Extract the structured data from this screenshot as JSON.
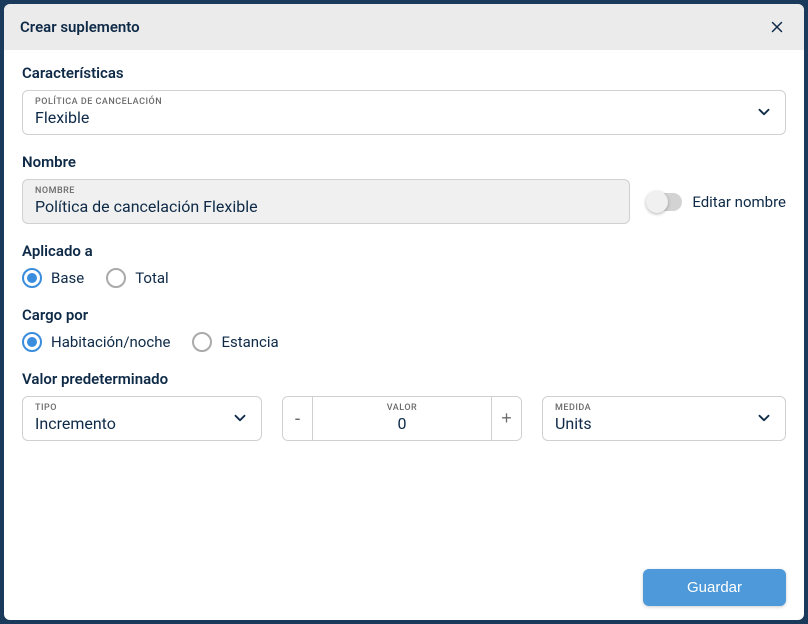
{
  "modal": {
    "title": "Crear suplemento",
    "footer": {
      "save_label": "Guardar"
    }
  },
  "caracteristicas": {
    "section_title": "Características",
    "select": {
      "label": "POLÍTICA DE CANCELACIÓN",
      "value": "Flexible"
    }
  },
  "nombre": {
    "section_title": "Nombre",
    "field": {
      "label": "NOMBRE",
      "value": "Política de cancelación Flexible"
    },
    "toggle_label": "Editar nombre"
  },
  "aplicado": {
    "section_title": "Aplicado a",
    "options": {
      "base": "Base",
      "total": "Total"
    }
  },
  "cargo": {
    "section_title": "Cargo por",
    "options": {
      "habitacion": "Habitación/noche",
      "estancia": "Estancia"
    }
  },
  "valor_pred": {
    "section_title": "Valor predeterminado",
    "tipo": {
      "label": "TIPO",
      "value": "Incremento"
    },
    "valor": {
      "label": "VALOR",
      "value": "0"
    },
    "medida": {
      "label": "MEDIDA",
      "value": "Units"
    },
    "stepper": {
      "minus": "-",
      "plus": "+"
    }
  }
}
